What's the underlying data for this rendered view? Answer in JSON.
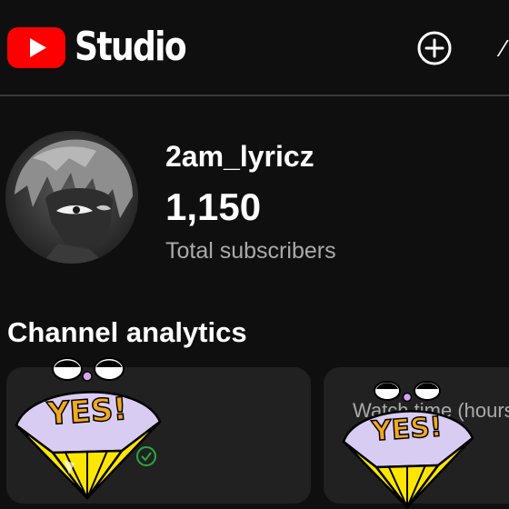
{
  "header": {
    "app_name": "Studio",
    "logo_icon": "youtube-play-icon",
    "create_icon": "plus-circle-icon"
  },
  "channel": {
    "name": "2am_lyricz",
    "subscriber_count": "1,150",
    "subscriber_label": "Total subscribers"
  },
  "analytics": {
    "title": "Channel analytics",
    "cards": [
      {
        "label": "",
        "value": ""
      },
      {
        "label": "Watch time (hours)"
      }
    ]
  },
  "stickers": [
    {
      "text": "YES!"
    },
    {
      "text": "YES!"
    }
  ],
  "colors": {
    "background": "#0f0f0f",
    "card": "#212121",
    "youtube_red": "#ff0000",
    "secondary_text": "#aaaaaa",
    "sticker_lavender": "#d9ccf3",
    "sticker_yellow": "#ffe600",
    "sticker_text": "#f2a81d"
  }
}
